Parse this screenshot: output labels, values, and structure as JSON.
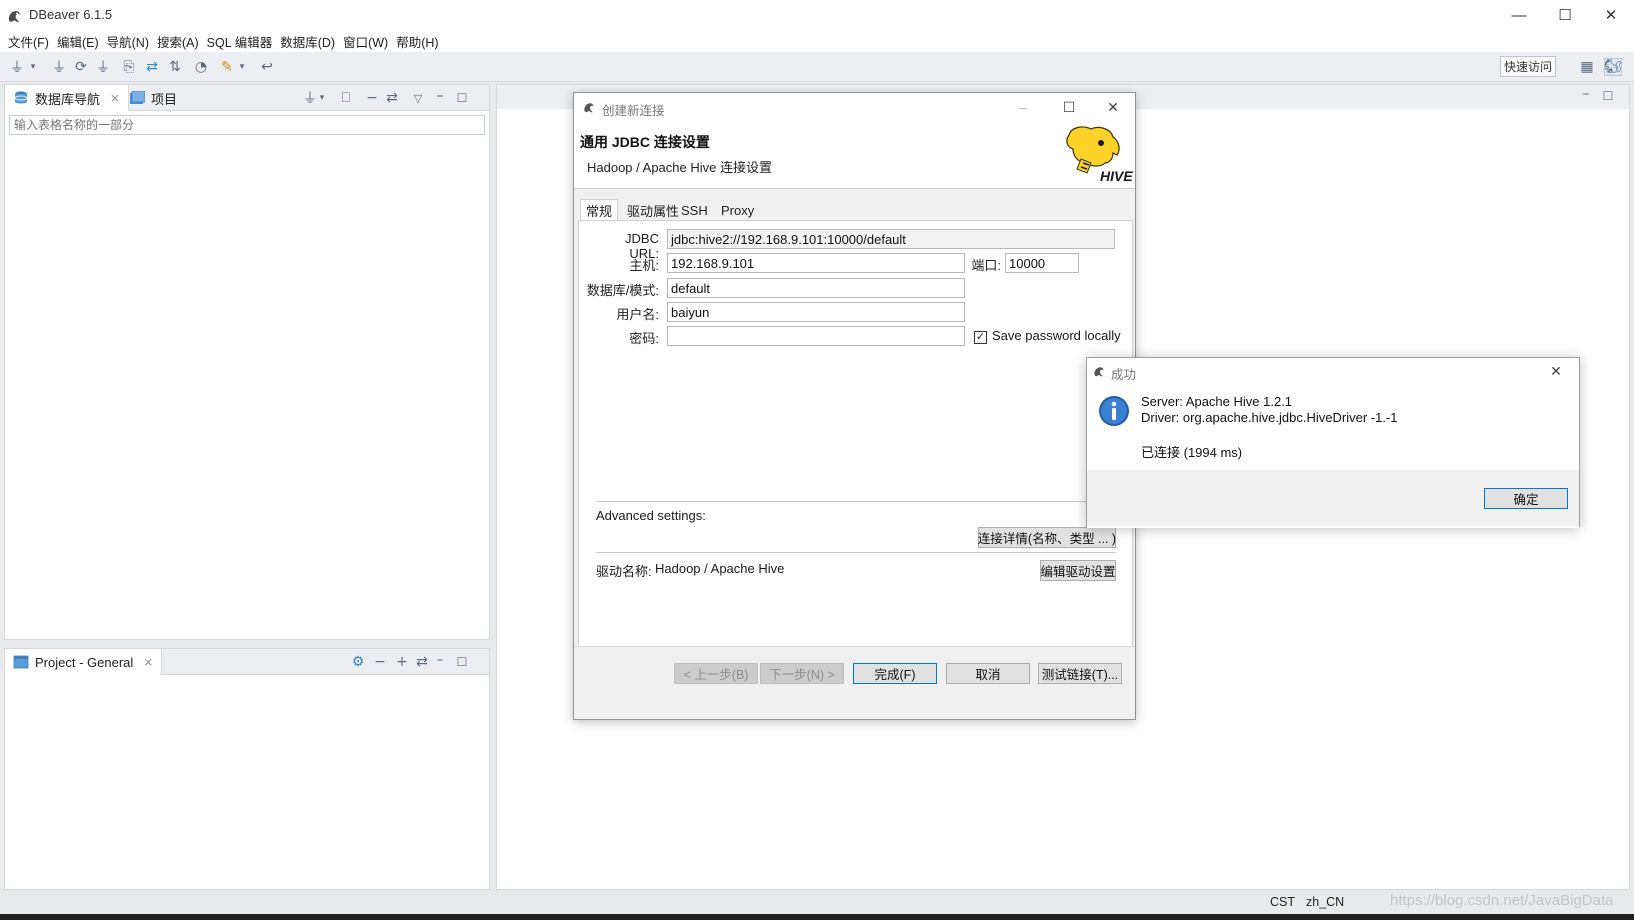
{
  "window": {
    "title": "DBeaver 6.1.5",
    "minimize": "—",
    "maximize": "☐",
    "close": "✕"
  },
  "menu": [
    "文件(F)",
    "编辑(E)",
    "导航(N)",
    "搜索(A)",
    "SQL 编辑器",
    "数据库(D)",
    "窗口(W)",
    "帮助(H)"
  ],
  "toolbar": {
    "quick_access": "快速访问"
  },
  "db_navigator": {
    "tab_label": "数据库导航",
    "project_tab_label": "项目",
    "search_placeholder": "输入表格名称的一部分"
  },
  "project_panel": {
    "tab_label": "Project - General"
  },
  "statusbar": {
    "timezone": "CST",
    "locale": "zh_CN",
    "watermark": "https://blog.csdn.net/JavaBigData"
  },
  "conn_dialog": {
    "title": "创建新连接",
    "heading": "通用 JDBC 连接设置",
    "subheading": "Hadoop / Apache Hive 连接设置",
    "tabs": [
      "常规",
      "驱动属性",
      "SSH",
      "Proxy"
    ],
    "jdbc_url_label": "JDBC URL:",
    "jdbc_url_value": "jdbc:hive2://192.168.9.101:10000/default",
    "host_label": "主机:",
    "host_value": "192.168.9.101",
    "port_label": "端口:",
    "port_value": "10000",
    "database_label": "数据库/模式:",
    "database_value": "default",
    "username_label": "用户名:",
    "username_value": "baiyun",
    "password_label": "密码:",
    "password_value": "",
    "save_password_label": "Save password locally",
    "save_password_checked": true,
    "advanced_label": "Advanced settings:",
    "connection_details_button": "连接详情(名称、类型 ... )",
    "driver_name_label": "驱动名称:",
    "driver_name_value": "Hadoop / Apache Hive",
    "edit_driver_button": "编辑驱动设置",
    "back_button": "< 上一步(B)",
    "next_button": "下一步(N) >",
    "finish_button": "完成(F)",
    "cancel_button": "取消",
    "test_button": "测试链接(T)..."
  },
  "success_dialog": {
    "title": "成功",
    "server_line": "Server: Apache Hive 1.2.1",
    "driver_line": "Driver: org.apache.hive.jdbc.HiveDriver -1.-1",
    "connected_line": "已连接 (1994 ms)",
    "ok_button": "确定"
  }
}
